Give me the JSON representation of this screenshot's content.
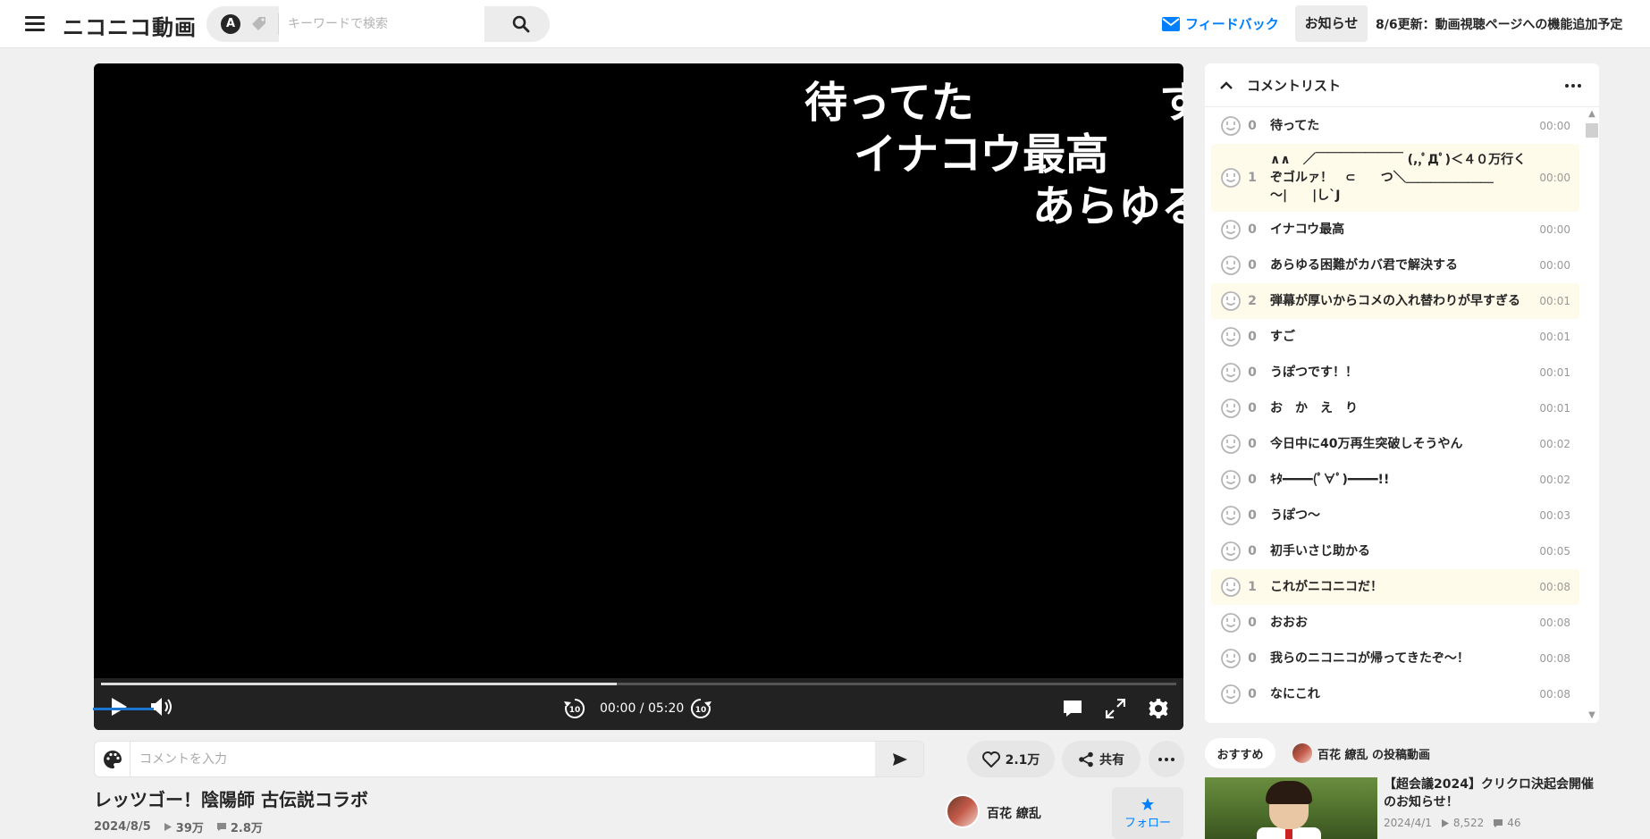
{
  "header": {
    "logo": "ニコニコ動画",
    "search_placeholder": "キーワードで検索",
    "search_mode": "A",
    "feedback_label": "フィードバック",
    "news_label": "お知らせ",
    "news_text": "8/6更新：動画視聴ページへの機能追加予定"
  },
  "player": {
    "danmaku": [
      "待ってた",
      "す",
      "イナコウ最高",
      "あらゆる"
    ],
    "time": "00:00 / 05:20",
    "buffer_fraction": 0.48,
    "volume_fraction": 0.6
  },
  "comment_input": {
    "placeholder": "コメントを入力"
  },
  "actions": {
    "like_count": "2.1万",
    "share_label": "共有"
  },
  "video": {
    "title": "レッツゴー！陰陽師 古伝説コラボ",
    "date": "2024/8/5",
    "views": "39万",
    "comments": "2.8万"
  },
  "owner": {
    "name": "百花 繚乱",
    "follow_label": "フォロー"
  },
  "comment_panel": {
    "title": "コメントリスト",
    "items": [
      {
        "count": "0",
        "text": "待ってた",
        "time": "00:00",
        "hl": false
      },
      {
        "count": "1",
        "text": "∧∧　／￣￣￣￣￣￣￣ (,,ﾟДﾟ)＜４０万行くぞゴルァ！　⊂　　つ＼＿＿＿＿＿＿＿ 〜|　　|し`J",
        "time": "00:00",
        "hl": true,
        "multi": true
      },
      {
        "count": "0",
        "text": "イナコウ最高",
        "time": "00:00",
        "hl": false
      },
      {
        "count": "0",
        "text": "あらゆる困難がカバ君で解決する",
        "time": "00:00",
        "hl": false
      },
      {
        "count": "2",
        "text": "弾幕が厚いからコメの入れ替わりが早すぎる",
        "time": "00:01",
        "hl": true
      },
      {
        "count": "0",
        "text": "すご",
        "time": "00:01",
        "hl": false
      },
      {
        "count": "0",
        "text": "うぽつです！！",
        "time": "00:01",
        "hl": false
      },
      {
        "count": "0",
        "text": "お　か　え　り",
        "time": "00:01",
        "hl": false
      },
      {
        "count": "0",
        "text": "今日中に40万再生突破しそうやん",
        "time": "00:02",
        "hl": false
      },
      {
        "count": "0",
        "text": "ｷﾀ━━━━(ﾟ∀ﾟ)━━━━!!",
        "time": "00:02",
        "hl": false
      },
      {
        "count": "0",
        "text": "うぽつ～",
        "time": "00:03",
        "hl": false
      },
      {
        "count": "0",
        "text": "初手いさじ助かる",
        "time": "00:05",
        "hl": false
      },
      {
        "count": "1",
        "text": "これがニコニコだ！",
        "time": "00:08",
        "hl": true
      },
      {
        "count": "0",
        "text": "おおお",
        "time": "00:08",
        "hl": false
      },
      {
        "count": "0",
        "text": "我らのニコニコが帰ってきたぞ～！",
        "time": "00:08",
        "hl": false
      },
      {
        "count": "0",
        "text": "なにこれ",
        "time": "00:08",
        "hl": false
      }
    ]
  },
  "recommend": {
    "tab_active": "おすすめ",
    "tab_other": "百花 繚乱 の投稿動画",
    "item_title": "【超会議2024】クリクロ決起会開催のお知らせ！",
    "item_date": "2024/4/1",
    "item_views": "8,522",
    "item_comments": "46"
  },
  "colors": {
    "accent": "#0080ff",
    "volume": "#1976d2",
    "highlight_row": "#fffbea"
  }
}
